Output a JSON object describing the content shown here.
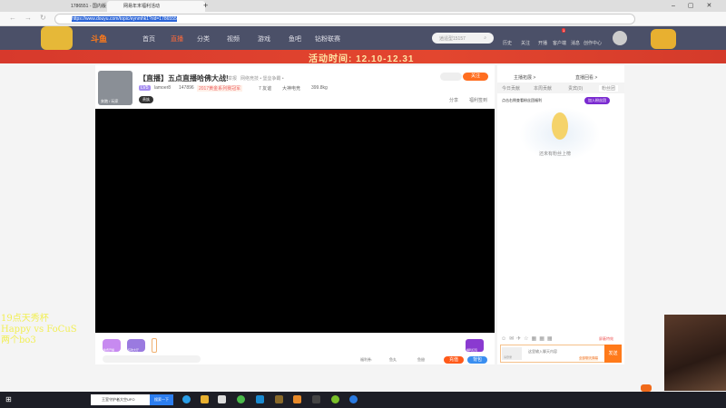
{
  "browser": {
    "tabs": [
      {
        "title": "1786551 - 国内版 Bing"
      },
      {
        "title": "网易年末福利活动"
      }
    ],
    "url": "https://www.douyu.com/topic/eynmhk1?rid=1786555"
  },
  "site": {
    "logo": "斗鱼",
    "nav": [
      "首页",
      "直播",
      "分类",
      "视频",
      "游戏",
      "鱼吧",
      "钻粉联赛"
    ],
    "search_placeholder": "逍遥型15157",
    "user_menu": [
      "历史",
      "关注",
      "开播",
      "客户端",
      "消息",
      "创作中心"
    ],
    "notification_count": "1"
  },
  "banner": {
    "text": "活动时间: 12.10-12.31"
  },
  "room": {
    "title": "【直播】五点直播哈佛大战!",
    "report": "举报",
    "category": "网络竞技 • 堡垒争霸 •",
    "level": "LV5",
    "streamer": "lamoer8",
    "heat": "147896",
    "badge": "2017黄金系列赛冠军",
    "fans": "7 友谊",
    "clan": "大神电竞",
    "weight": "399.8kg",
    "follow": "关注",
    "share": "分享",
    "sign": "福利签到",
    "avatar_caption": "奔跑 / 玩家",
    "noble": "贵族"
  },
  "player": {
    "gifts": [
      "免费开播",
      "狂欢大厅"
    ],
    "right_gift": "福利红包",
    "tools": [
      "福利券:",
      "鱼丸",
      "鱼翅"
    ],
    "recharge": "充值",
    "backpack": "背包"
  },
  "sidebar": {
    "links": [
      "主播拓展 >",
      "直播回看 >"
    ],
    "tabs": [
      "今日贡献",
      "本周贡献",
      "贵宾(0)",
      "粉丝团"
    ],
    "promo": "点击右侧查看粉丝团福利",
    "join": "加入粉丝团",
    "empty": "还未有粉丝上榜",
    "chat_placeholder": "这里输入聊天内容",
    "chat_hint": "全部聊天弹幕",
    "send": "发送",
    "barrage": "屏蔽特效",
    "login": "请登录"
  },
  "overlay": {
    "lines": [
      "19点天秀杯",
      "Happy vs FoCuS",
      "两个bo3"
    ]
  },
  "taskbar": {
    "search": "王室守护者大空UFO",
    "search_btn": "搜索一下"
  }
}
